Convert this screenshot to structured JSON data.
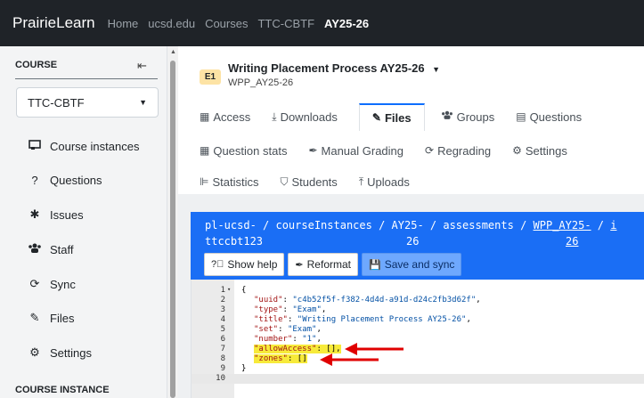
{
  "topnav": {
    "brand": "PrairieLearn",
    "links": [
      "Home",
      "ucsd.edu",
      "Courses",
      "TTC-CBTF",
      "AY25-26"
    ]
  },
  "sidebar": {
    "course_heading": "COURSE",
    "collapse_icon": "collapse-arrow-icon",
    "course_select": "TTC-CBTF",
    "items": [
      {
        "label": "Course instances",
        "icon": "chalkboard-icon"
      },
      {
        "label": "Questions",
        "icon": "question-icon"
      },
      {
        "label": "Issues",
        "icon": "bug-icon"
      },
      {
        "label": "Staff",
        "icon": "users-icon"
      },
      {
        "label": "Sync",
        "icon": "sync-icon"
      },
      {
        "label": "Files",
        "icon": "edit-icon"
      },
      {
        "label": "Settings",
        "icon": "gear-icon"
      }
    ],
    "instance_heading": "COURSE INSTANCE"
  },
  "assessment": {
    "badge": "E1",
    "title": "Writing Placement Process AY25-26",
    "subtitle": "WPP_AY25-26"
  },
  "tabs_row1": [
    {
      "label": "Access",
      "icon": "table-icon"
    },
    {
      "label": "Downloads",
      "icon": "download-icon"
    },
    {
      "label": "Files",
      "icon": "edit-icon",
      "active": true
    },
    {
      "label": "Groups",
      "icon": "users-icon"
    },
    {
      "label": "Questions",
      "icon": "file-icon"
    }
  ],
  "tabs_row2": [
    {
      "label": "Question stats",
      "icon": "table-icon"
    },
    {
      "label": "Manual Grading",
      "icon": "marker-icon"
    },
    {
      "label": "Regrading",
      "icon": "sync-icon"
    },
    {
      "label": "Settings",
      "icon": "gear-icon"
    }
  ],
  "tabs_row3": [
    {
      "label": "Statistics",
      "icon": "chart-icon"
    },
    {
      "label": "Students",
      "icon": "students-icon"
    },
    {
      "label": "Uploads",
      "icon": "upload-icon"
    }
  ],
  "path": {
    "line1": [
      "pl-ucsd-",
      " / ",
      "courseInstances",
      " / ",
      "AY25-",
      " / ",
      "assessments",
      " / ",
      "WPP_AY25-",
      " / ",
      "i"
    ],
    "line2": [
      "ttccbt123",
      "26",
      "26"
    ]
  },
  "buttons": {
    "help": "Show help",
    "reformat": "Reformat",
    "save": "Save and sync"
  },
  "code_lines": [
    {
      "n": "1",
      "text": "{",
      "fold": true
    },
    {
      "n": "2",
      "key": "\"uuid\"",
      "val": "\"c4b52f5f-f382-4d4d-a91d-d24c2fb3d62f\"",
      "end": ","
    },
    {
      "n": "3",
      "key": "\"type\"",
      "val": "\"Exam\"",
      "end": ","
    },
    {
      "n": "4",
      "key": "\"title\"",
      "val": "\"Writing Placement Process AY25-26\"",
      "end": ","
    },
    {
      "n": "5",
      "key": "\"set\"",
      "val": "\"Exam\"",
      "end": ","
    },
    {
      "n": "6",
      "key": "\"number\"",
      "val": "\"1\"",
      "end": ","
    },
    {
      "n": "7",
      "key": "\"allowAccess\"",
      "val": "[]",
      "end": ",",
      "highlight": true
    },
    {
      "n": "8",
      "key": "\"zones\"",
      "val": "[]",
      "end": "",
      "highlight": true
    },
    {
      "n": "9",
      "text": "}"
    },
    {
      "n": "10",
      "text": ""
    }
  ],
  "colors": {
    "nav_bg": "#1f2328",
    "editor_header": "#1a6ef5",
    "highlight": "#f7ea3a",
    "arrow": "#e00000"
  }
}
